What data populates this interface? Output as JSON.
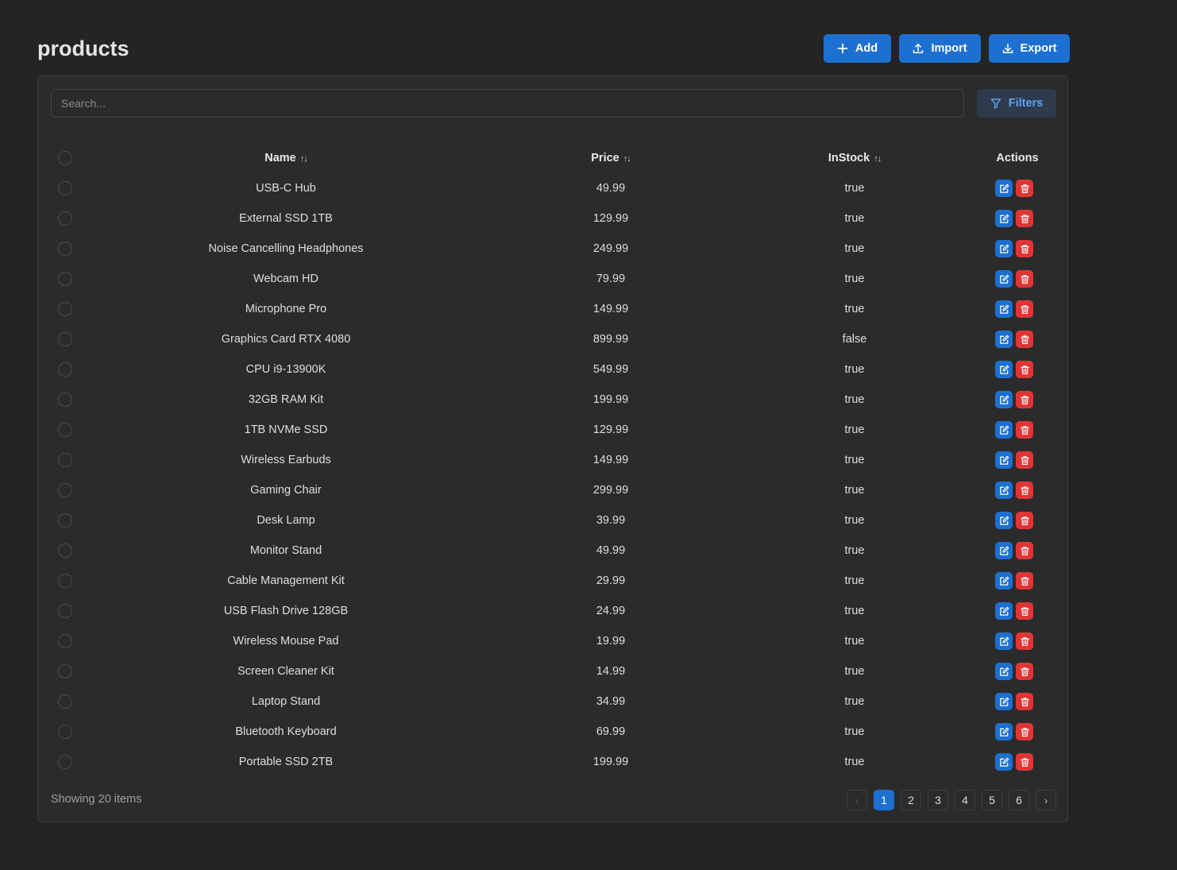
{
  "page": {
    "title": "products"
  },
  "toolbar": {
    "add_label": "Add",
    "import_label": "Import",
    "export_label": "Export"
  },
  "search": {
    "placeholder": "Search...",
    "value": ""
  },
  "filters": {
    "label": "Filters"
  },
  "table": {
    "columns": {
      "name": "Name",
      "price": "Price",
      "instock": "InStock",
      "actions": "Actions"
    },
    "rows": [
      {
        "name": "USB-C Hub",
        "price": "49.99",
        "instock": "true"
      },
      {
        "name": "External SSD 1TB",
        "price": "129.99",
        "instock": "true"
      },
      {
        "name": "Noise Cancelling Headphones",
        "price": "249.99",
        "instock": "true"
      },
      {
        "name": "Webcam HD",
        "price": "79.99",
        "instock": "true"
      },
      {
        "name": "Microphone Pro",
        "price": "149.99",
        "instock": "true"
      },
      {
        "name": "Graphics Card RTX 4080",
        "price": "899.99",
        "instock": "false"
      },
      {
        "name": "CPU i9-13900K",
        "price": "549.99",
        "instock": "true"
      },
      {
        "name": "32GB RAM Kit",
        "price": "199.99",
        "instock": "true"
      },
      {
        "name": "1TB NVMe SSD",
        "price": "129.99",
        "instock": "true"
      },
      {
        "name": "Wireless Earbuds",
        "price": "149.99",
        "instock": "true"
      },
      {
        "name": "Gaming Chair",
        "price": "299.99",
        "instock": "true"
      },
      {
        "name": "Desk Lamp",
        "price": "39.99",
        "instock": "true"
      },
      {
        "name": "Monitor Stand",
        "price": "49.99",
        "instock": "true"
      },
      {
        "name": "Cable Management Kit",
        "price": "29.99",
        "instock": "true"
      },
      {
        "name": "USB Flash Drive 128GB",
        "price": "24.99",
        "instock": "true"
      },
      {
        "name": "Wireless Mouse Pad",
        "price": "19.99",
        "instock": "true"
      },
      {
        "name": "Screen Cleaner Kit",
        "price": "14.99",
        "instock": "true"
      },
      {
        "name": "Laptop Stand",
        "price": "34.99",
        "instock": "true"
      },
      {
        "name": "Bluetooth Keyboard",
        "price": "69.99",
        "instock": "true"
      },
      {
        "name": "Portable SSD 2TB",
        "price": "199.99",
        "instock": "true"
      }
    ]
  },
  "footer": {
    "showing_text": "Showing 20 items"
  },
  "pagination": {
    "pages": [
      "1",
      "2",
      "3",
      "4",
      "5",
      "6"
    ],
    "current": "1",
    "prev_icon": "chevron-left-icon",
    "next_icon": "chevron-right-icon"
  },
  "icons": {
    "add": "plus-icon",
    "import": "upload-icon",
    "export": "download-icon",
    "filters": "filter-icon",
    "sort": "sort-icon",
    "edit": "edit-icon",
    "delete": "trash-icon"
  },
  "colors": {
    "primary": "#1d6fd0",
    "danger": "#e03535",
    "background": "#242424",
    "card": "#2b2b2b",
    "filters_text": "#5fa3f0"
  }
}
